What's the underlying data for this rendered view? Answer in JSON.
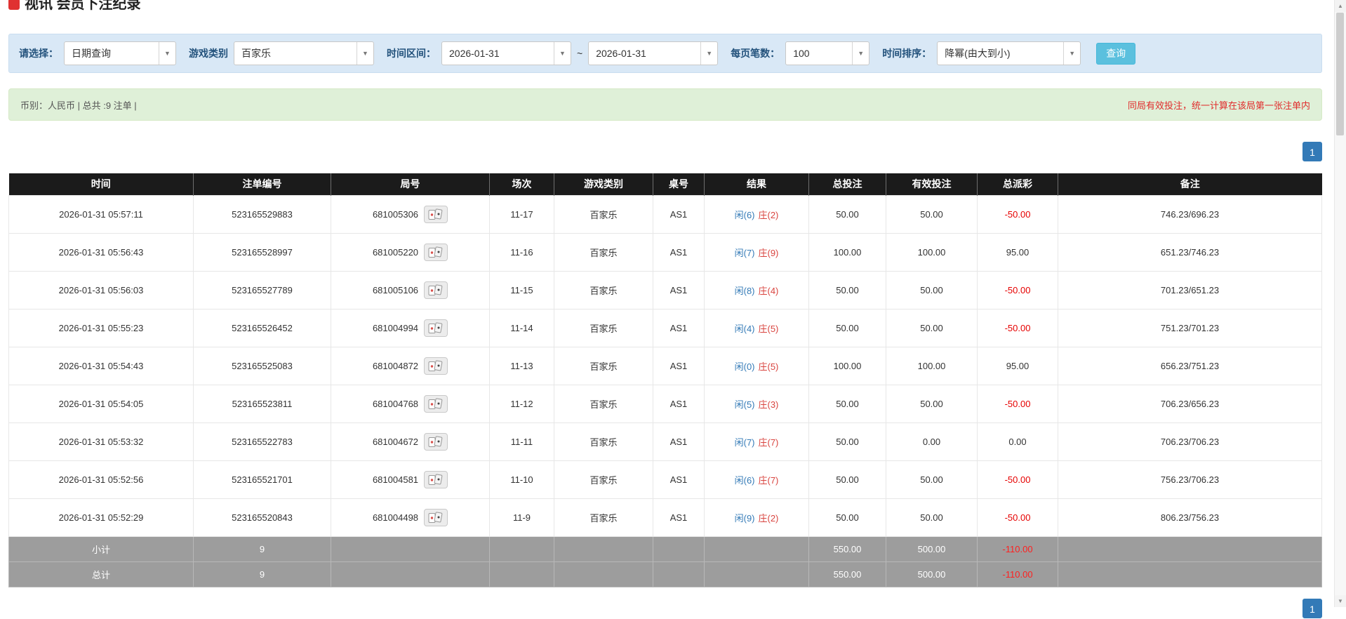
{
  "page": {
    "title": "视讯 会员下注纪录"
  },
  "filter": {
    "select_label": "请选择：",
    "select_value": "日期查询",
    "game_label": "游戏类别",
    "game_value": "百家乐",
    "time_label": "时间区间：",
    "date_from": "2026-01-31",
    "tilde": "~",
    "date_to": "2026-01-31",
    "per_page_label": "每页笔数：",
    "per_page_value": "100",
    "sort_label": "时间排序：",
    "sort_value": "降幂(由大到小)",
    "query_button": "查询"
  },
  "summary": {
    "left": "币别：人民币 | 总共 :9 注单 |",
    "right": "同局有效投注，统一计算在该局第一张注单内"
  },
  "pagination": {
    "page": "1"
  },
  "icons": {
    "caret": "▼",
    "scroll_up": "▲",
    "scroll_down": "▼"
  },
  "table": {
    "headers": [
      "时间",
      "注单编号",
      "局号",
      "场次",
      "游戏类别",
      "桌号",
      "结果",
      "总投注",
      "有效投注",
      "总派彩",
      "备注"
    ],
    "rows": [
      {
        "time": "2026-01-31 05:57:11",
        "bet_no": "523165529883",
        "round": "681005306",
        "session": "11-17",
        "game": "百家乐",
        "table_no": "AS1",
        "result_player": "闲(6)",
        "result_banker": "庄(2)",
        "total_bet": "50.00",
        "valid_bet": "50.00",
        "payout": "-50.00",
        "remark": "746.23/696.23"
      },
      {
        "time": "2026-01-31 05:56:43",
        "bet_no": "523165528997",
        "round": "681005220",
        "session": "11-16",
        "game": "百家乐",
        "table_no": "AS1",
        "result_player": "闲(7)",
        "result_banker": "庄(9)",
        "total_bet": "100.00",
        "valid_bet": "100.00",
        "payout": "95.00",
        "remark": "651.23/746.23"
      },
      {
        "time": "2026-01-31 05:56:03",
        "bet_no": "523165527789",
        "round": "681005106",
        "session": "11-15",
        "game": "百家乐",
        "table_no": "AS1",
        "result_player": "闲(8)",
        "result_banker": "庄(4)",
        "total_bet": "50.00",
        "valid_bet": "50.00",
        "payout": "-50.00",
        "remark": "701.23/651.23"
      },
      {
        "time": "2026-01-31 05:55:23",
        "bet_no": "523165526452",
        "round": "681004994",
        "session": "11-14",
        "game": "百家乐",
        "table_no": "AS1",
        "result_player": "闲(4)",
        "result_banker": "庄(5)",
        "total_bet": "50.00",
        "valid_bet": "50.00",
        "payout": "-50.00",
        "remark": "751.23/701.23"
      },
      {
        "time": "2026-01-31 05:54:43",
        "bet_no": "523165525083",
        "round": "681004872",
        "session": "11-13",
        "game": "百家乐",
        "table_no": "AS1",
        "result_player": "闲(0)",
        "result_banker": "庄(5)",
        "total_bet": "100.00",
        "valid_bet": "100.00",
        "payout": "95.00",
        "remark": "656.23/751.23"
      },
      {
        "time": "2026-01-31 05:54:05",
        "bet_no": "523165523811",
        "round": "681004768",
        "session": "11-12",
        "game": "百家乐",
        "table_no": "AS1",
        "result_player": "闲(5)",
        "result_banker": "庄(3)",
        "total_bet": "50.00",
        "valid_bet": "50.00",
        "payout": "-50.00",
        "remark": "706.23/656.23"
      },
      {
        "time": "2026-01-31 05:53:32",
        "bet_no": "523165522783",
        "round": "681004672",
        "session": "11-11",
        "game": "百家乐",
        "table_no": "AS1",
        "result_player": "闲(7)",
        "result_banker": "庄(7)",
        "total_bet": "50.00",
        "valid_bet": "0.00",
        "payout": "0.00",
        "remark": "706.23/706.23"
      },
      {
        "time": "2026-01-31 05:52:56",
        "bet_no": "523165521701",
        "round": "681004581",
        "session": "11-10",
        "game": "百家乐",
        "table_no": "AS1",
        "result_player": "闲(6)",
        "result_banker": "庄(7)",
        "total_bet": "50.00",
        "valid_bet": "50.00",
        "payout": "-50.00",
        "remark": "756.23/706.23"
      },
      {
        "time": "2026-01-31 05:52:29",
        "bet_no": "523165520843",
        "round": "681004498",
        "session": "11-9",
        "game": "百家乐",
        "table_no": "AS1",
        "result_player": "闲(9)",
        "result_banker": "庄(2)",
        "total_bet": "50.00",
        "valid_bet": "50.00",
        "payout": "-50.00",
        "remark": "806.23/756.23"
      }
    ],
    "footer": [
      {
        "label": "小计",
        "count": "9",
        "total_bet": "550.00",
        "valid_bet": "500.00",
        "payout": "-110.00"
      },
      {
        "label": "总计",
        "count": "9",
        "total_bet": "550.00",
        "valid_bet": "500.00",
        "payout": "-110.00"
      }
    ]
  },
  "colors": {
    "accent_blue": "#337ab7",
    "info_button": "#5bc0de",
    "negative_red": "#e60000",
    "banker_red": "#d9443f",
    "player_blue": "#337ab7",
    "summary_bg": "#dff0d8",
    "filter_bg": "#d9e8f6",
    "header_bg": "#1b1b1b",
    "footer_bg": "#9d9d9d"
  }
}
